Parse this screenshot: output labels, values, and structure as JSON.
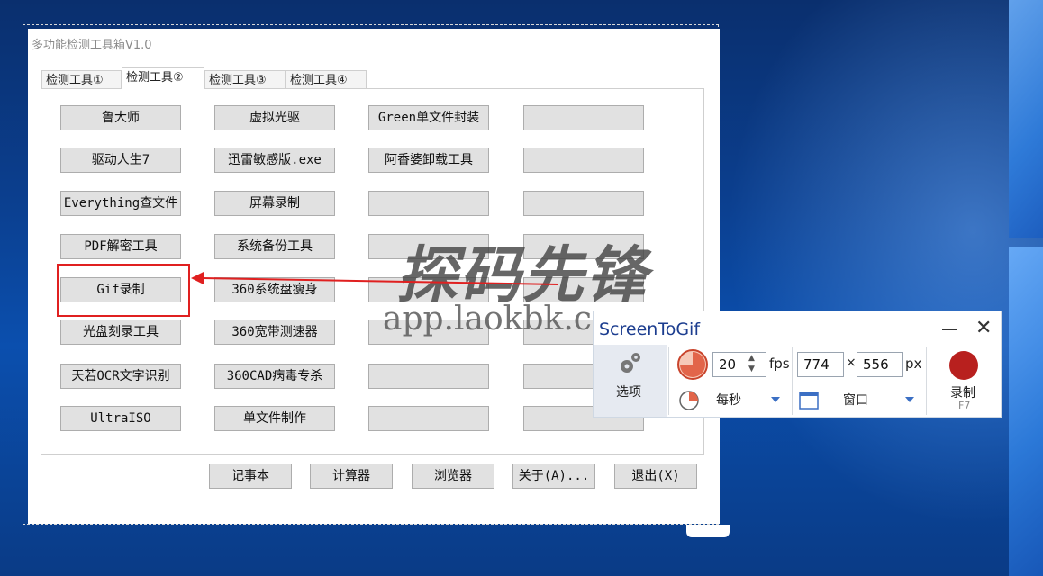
{
  "window": {
    "title": "多功能检测工具箱V1.0"
  },
  "tabs": [
    "检测工具①",
    "检测工具②",
    "检测工具③",
    "检测工具④"
  ],
  "grid": [
    [
      "鲁大师",
      "虚拟光驱",
      "Green单文件封装",
      ""
    ],
    [
      "驱动人生7",
      "迅雷敏感版.exe",
      "阿香婆卸载工具",
      ""
    ],
    [
      "Everything查文件",
      "屏幕录制",
      "",
      ""
    ],
    [
      "PDF解密工具",
      "系统备份工具",
      "",
      ""
    ],
    [
      "Gif录制",
      "360系统盘瘦身",
      "",
      ""
    ],
    [
      "光盘刻录工具",
      "360宽带测速器",
      "",
      ""
    ],
    [
      "天若OCR文字识别",
      "360CAD病毒专杀",
      "",
      ""
    ],
    [
      "UltraISO",
      "单文件制作",
      "",
      ""
    ]
  ],
  "bottom": [
    "记事本",
    "计算器",
    "浏览器",
    "关于(A)...",
    "退出(X)"
  ],
  "watermark": {
    "line1": "探码先锋",
    "line2": "app.laokbk.cn"
  },
  "screentogif": {
    "title": "ScreenToGif",
    "close": "✕",
    "options_label": "选项",
    "fps_value": "20",
    "fps_unit": "fps",
    "width": "774",
    "times": "×",
    "height": "556",
    "px_unit": "px",
    "rate_mode": "每秒",
    "capture_mode": "窗口",
    "record_label": "录制",
    "record_key": "F7"
  },
  "colors": {
    "highlight": "#e02020",
    "record": "#b8201e",
    "accent": "#1c3d8f"
  }
}
